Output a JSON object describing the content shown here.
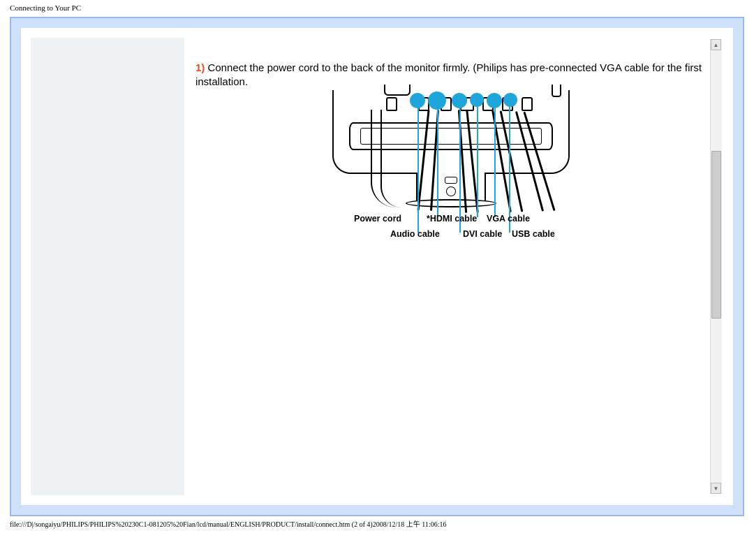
{
  "header": {
    "title": "Connecting to Your PC"
  },
  "instruction": {
    "step_number": "1)",
    "text": " Connect the power cord to the back of the monitor firmly. (Philips has pre-connected VGA cable for the first installation."
  },
  "diagram": {
    "labels": {
      "power": "Power cord",
      "hdmi": "*HDMI cable",
      "vga": "VGA cable",
      "audio": "Audio cable",
      "dvi": "DVI cable",
      "usb": "USB cable"
    }
  },
  "footer": {
    "path": "file:///D|/songaiyu/PHILIPS/PHILIPS%20230C1-081205%20Fian/lcd/manual/ENGLISH/PRODUCT/install/connect.htm (2 of 4)2008/12/18 上午 11:06:16"
  },
  "scrollbar": {
    "up": "▲",
    "down": "▼"
  }
}
